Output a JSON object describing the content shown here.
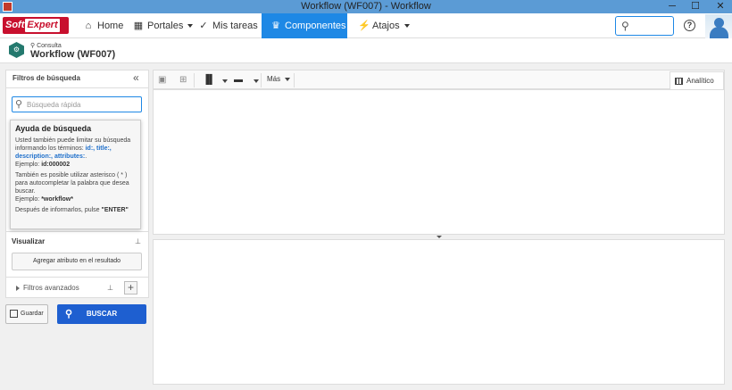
{
  "window": {
    "title": "Workflow (WF007) - Workflow",
    "minimize_glyph": "─",
    "maximize_glyph": "☐",
    "close_glyph": "✕"
  },
  "navbar": {
    "logo_part1": "Soft",
    "logo_part2": "Expert",
    "items": [
      {
        "label": "Home",
        "icon": "home-icon",
        "glyph": "⌂"
      },
      {
        "label": "Portales",
        "icon": "grid-icon",
        "glyph": "▦"
      },
      {
        "label": "Mis tareas",
        "icon": "check-icon",
        "glyph": "✓"
      },
      {
        "label": "Componentes",
        "icon": "trophy-icon",
        "glyph": "♛"
      },
      {
        "label": "Atajos",
        "icon": "bolt-icon",
        "glyph": "⚡"
      }
    ],
    "search_glyph": "⚲",
    "help_glyph": "?"
  },
  "page_header": {
    "subtitle": "Consulta",
    "title": "Workflow (WF007)"
  },
  "sidebar": {
    "title": "Filtros de búsqueda",
    "collapse_glyph": "«",
    "quick_search_placeholder": "Búsqueda rápida",
    "visualize_label": "Visualizar",
    "add_attribute_label": "Agregar atributo en el resultado",
    "advanced_filters_label": "Filtros avanzados",
    "pin_glyph": "⊥",
    "add_glyph": "+",
    "save_label": "Guardar",
    "search_button_label": "BUSCAR",
    "search_glyph": "⚲"
  },
  "tooltip": {
    "title": "Ayuda de búsqueda",
    "p1_text": "Usted también puede limitar su búsqueda informando los términos: ",
    "p1_terms": "id:, title:, description:, attributes:",
    "p1_end": ".",
    "example_label": "Ejemplo: ",
    "example1_value": "id:000002",
    "p2_text": "También es posible utilizar asterisco ( * ) para autocompletar la palabra que desea buscar.",
    "example2_value": "*workflow*",
    "p3_text": "Después de informarlos, pulse ",
    "p3_key": "\"ENTER\""
  },
  "toolbar": {
    "more_label": "Más",
    "analytic_tab_label": "Analítico"
  }
}
